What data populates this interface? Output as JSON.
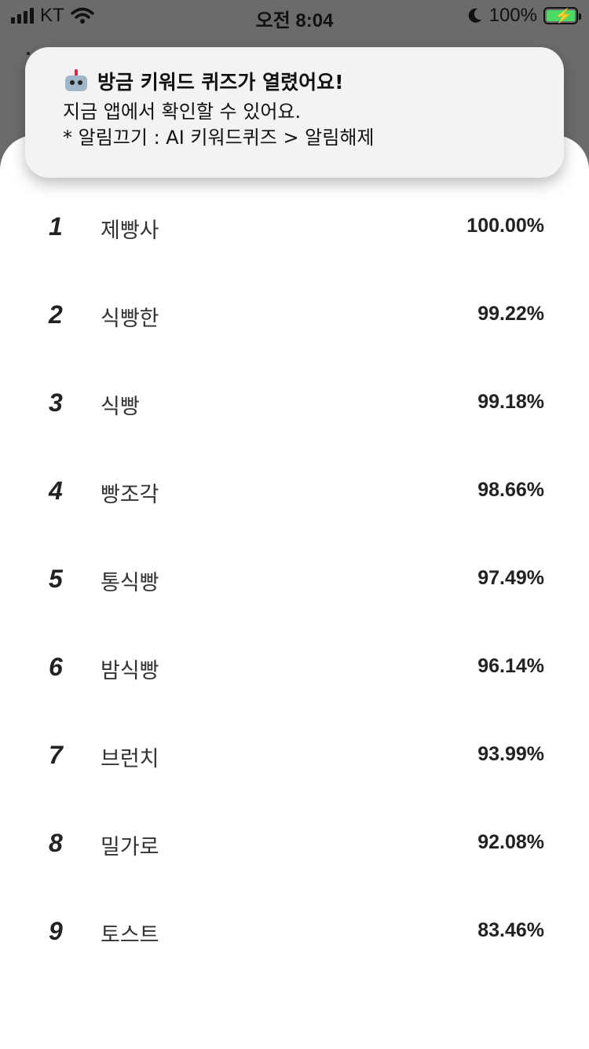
{
  "status_bar": {
    "carrier": "KT",
    "time": "오전 8:04",
    "battery": "100%",
    "icons": [
      "cellular-signal-icon",
      "wifi-icon",
      "moon-icon",
      "battery-charging-icon"
    ]
  },
  "notification": {
    "icon": "robot-icon",
    "title": "방금 키워드 퀴즈가 열렸어요!",
    "line1": "지금 앱에서 확인할 수 있어요.",
    "line2": "* 알림끄기 : AI 키워드퀴즈 > 알림해제"
  },
  "ranking": [
    {
      "rank": "1",
      "word": "제빵사",
      "score": "100.00%"
    },
    {
      "rank": "2",
      "word": "식빵한",
      "score": "99.22%"
    },
    {
      "rank": "3",
      "word": "식빵",
      "score": "99.18%"
    },
    {
      "rank": "4",
      "word": "빵조각",
      "score": "98.66%"
    },
    {
      "rank": "5",
      "word": "통식빵",
      "score": "97.49%"
    },
    {
      "rank": "6",
      "word": "밤식빵",
      "score": "96.14%"
    },
    {
      "rank": "7",
      "word": "브런치",
      "score": "93.99%"
    },
    {
      "rank": "8",
      "word": "밀가로",
      "score": "92.08%"
    },
    {
      "rank": "9",
      "word": "토스트",
      "score": "83.46%"
    }
  ],
  "colors": {
    "battery_fill": "#4cd964",
    "backdrop": "#6b6b6b",
    "sheet": "#ffffff",
    "banner": "#f3f3f3"
  }
}
